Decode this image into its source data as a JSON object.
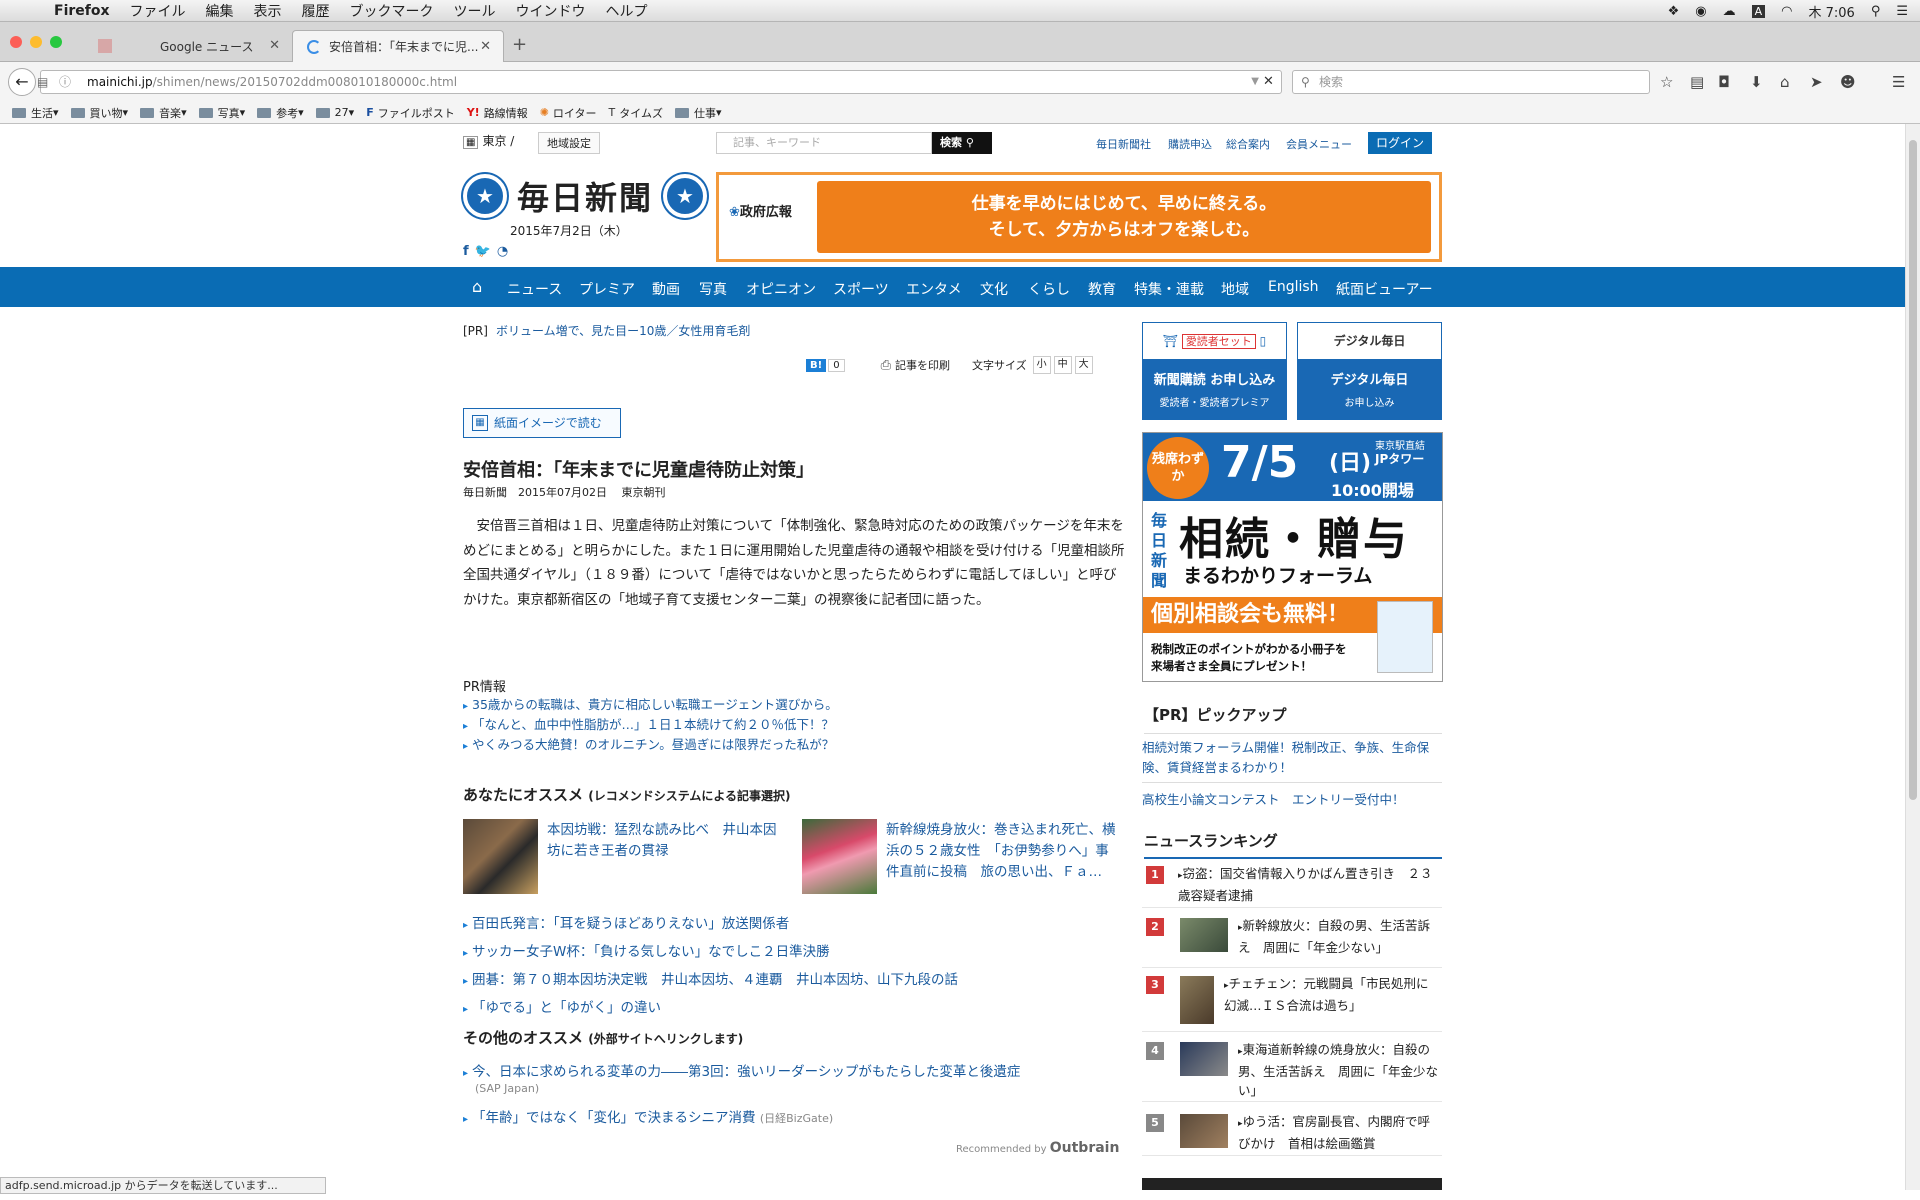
{
  "menubar": {
    "app": "Firefox",
    "items": [
      "ファイル",
      "編集",
      "表示",
      "履歴",
      "ブックマーク",
      "ツール",
      "ウインドウ",
      "ヘルプ"
    ],
    "clock": "木 7:06"
  },
  "tabs": [
    {
      "title": "Google ニュース"
    },
    {
      "title": "安倍首相：「年末までに児..."
    }
  ],
  "browser": {
    "url_domain": "mainichi.jp",
    "url_path": "/shimen/news/20150702ddm008010180000c.html",
    "search_placeholder": "検索"
  },
  "bookmarks": [
    {
      "label": "生活"
    },
    {
      "label": "買い物"
    },
    {
      "label": "音楽"
    },
    {
      "label": "写真"
    },
    {
      "label": "参考"
    },
    {
      "label": "27"
    },
    {
      "label": "ファイルポスト"
    },
    {
      "label": "路線情報"
    },
    {
      "label": "ロイター"
    },
    {
      "label": "タイムズ"
    },
    {
      "label": "仕事"
    }
  ],
  "util": {
    "pref": "東京",
    "area_btn": "地域設定",
    "search_placeholder": "記事、キーワード",
    "search_btn": "検索",
    "links": [
      "毎日新聞社",
      "購読申込",
      "総合案内",
      "会員メニュー"
    ],
    "login": "ログイン"
  },
  "masthead": {
    "logo": "毎日新聞",
    "date": "2015年7月2日（木）",
    "gov_label": "政府広報",
    "gov_line1": "仕事を早めにはじめて、早めに終える。",
    "gov_line2": "そして、夕方からはオフを楽しむ。"
  },
  "nav": [
    "ニュース",
    "プレミア",
    "動画",
    "写真",
    "オピニオン",
    "スポーツ",
    "エンタメ",
    "文化",
    "くらし",
    "教育",
    "特集・連載",
    "地域",
    "English",
    "紙面ビューアー"
  ],
  "article": {
    "pr_tag": "[PR]",
    "pr_link": "ボリューム増で、見た目ー10歳／女性用育毛剤",
    "hatena_count": "0",
    "print": "記事を印刷",
    "fontsize_label": "文字サイズ",
    "fs": [
      "小",
      "中",
      "大"
    ],
    "paper_btn": "紙面イメージで読む",
    "headline": "安倍首相：「年末までに児童虐待防止対策」",
    "byline": "毎日新聞　2015年07月02日　 東京朝刊",
    "body": "安倍晋三首相は１日、児童虐待防止対策について「体制強化、緊急時対応のための政策パッケージを年末をめどにまとめる」と明らかにした。また１日に運用開始した児童虐待の通報や相談を受け付ける「児童相談所全国共通ダイヤル」（１８９番）について「虐待ではないかと思ったらためらわずに電話してほしい」と呼びかけた。東京都新宿区の「地域子育て支援センター二葉」の視察後に記者団に語った。"
  },
  "pr_info": {
    "title": "PR情報",
    "links": [
      "35歳からの転職は、貴方に相応しい転職エージェント選びから。",
      "「なんと、血中中性脂肪が…」１日１本続けて約２０％低下！？",
      "やくみつる大絶賛！のオルニチン。昼過ぎには限界だった私が？"
    ]
  },
  "recommend": {
    "title": "あなたにオススメ",
    "subtitle": "(レコメンドシステムによる記事選択)",
    "cards": [
      {
        "text": "本因坊戦：猛烈な読み比べ　井山本因坊に若き王者の貫禄"
      },
      {
        "text": "新幹線焼身放火：巻き込まれ死亡、横浜の５２歳女性　「お伊勢参りへ」事件直前に投稿　旅の思い出、Ｆａ…"
      }
    ],
    "links": [
      "百田氏発言：「耳を疑うほどありえない」放送関係者",
      "サッカー女子W杯：「負ける気しない」なでしこ２日準決勝",
      "囲碁：第７０期本因坊決定戦　井山本因坊、４連覇　井山本因坊、山下九段の話",
      "「ゆでる」と「ゆがく」の違い"
    ]
  },
  "other": {
    "title": "その他のオススメ",
    "subtitle": "(外部サイトへリンクします)",
    "links": [
      {
        "text": "今、日本に求められる変革の力――第3回：強いリーダーシップがもたらした変革と後遺症",
        "src": "(SAP Japan)"
      },
      {
        "text": "「年齢」ではなく「変化」で決まるシニア消費",
        "src": "(日経BizGate)"
      }
    ],
    "recommended_by": "Recommended by",
    "outbrain": "Outbrain"
  },
  "sidebar": {
    "btn1_top": "愛読者セット",
    "btn1_main": "新聞購読 お申し込み",
    "btn1_sub": "愛読者・愛読者プレミア",
    "btn2_top": "デジタル毎日",
    "btn2_main": "デジタル毎日",
    "btn2_sub": "お申し込み",
    "forum_badge": "残席わずか",
    "forum_date": "7/5",
    "forum_day": "(日)",
    "forum_venue1": "東京駅直結",
    "forum_venue2": "JPタワー",
    "forum_time": "10:00開場",
    "forum_vert": "毎日新聞",
    "forum_big": "相続・贈与",
    "forum_sub": "まるわかりフォーラム",
    "forum_orange": "個別相談会も無料！",
    "forum_note1": "税制改正のポイントがわかる小冊子を",
    "forum_note2": "来場者さま全員にプレゼント！",
    "pickup_title": "【PR】ピックアップ",
    "pickups": [
      "相続対策フォーラム開催！税制改正、争族、生命保険、賃貸経営まるわかり！",
      "高校生小論文コンテスト　エントリー受付中！"
    ],
    "ranking_title": "ニュースランキング",
    "ranking": [
      {
        "num": "1",
        "text": "窃盗：国交省情報入りかばん置き引き　２３歳容疑者逮捕"
      },
      {
        "num": "2",
        "text": "新幹線放火：自殺の男、生活苦訴え　周囲に「年金少ない」"
      },
      {
        "num": "3",
        "text": "チェチェン：元戦闘員「市民処刑に幻滅…ＩＳ合流は過ち」"
      },
      {
        "num": "4",
        "text": "東海道新幹線の焼身放火：自殺の男、生活苦訴え　周囲に「年金少ない」"
      },
      {
        "num": "5",
        "text": "ゆう活：官房副長官、内閣府で呼びかけ　首相は絵画鑑賞"
      }
    ]
  },
  "status": "adfp.send.microad.jp からデータを転送しています...",
  "colors": {
    "brand_blue": "#0a6cb4",
    "link": "#1b5b9e",
    "orange": "#ef7f1a",
    "rank_red": "#d23a3a",
    "rank_gray": "#888888"
  }
}
